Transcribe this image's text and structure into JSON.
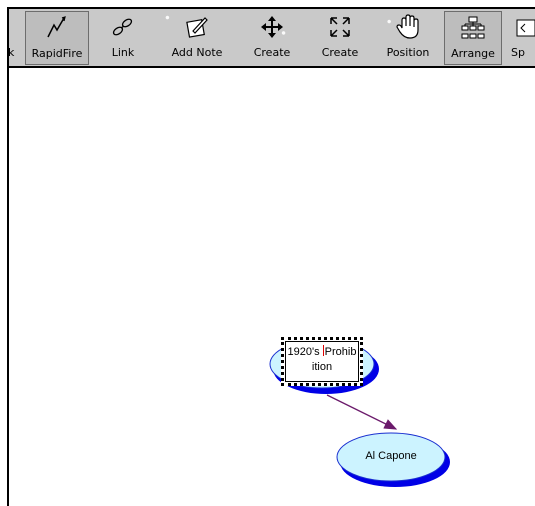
{
  "toolbar": {
    "tools": [
      {
        "label": "k",
        "icon": "partial-tool-icon",
        "active": false
      },
      {
        "label": "RapidFire",
        "icon": "rapidfire-lightning-icon",
        "active": true
      },
      {
        "label": "Link",
        "icon": "link-chain-icon",
        "active": false
      },
      {
        "label": "Add Note",
        "icon": "pencil-note-icon",
        "active": false
      },
      {
        "label": "Create",
        "icon": "create-move-arrows-icon",
        "active": false
      },
      {
        "label": "Create",
        "icon": "create-expand-arrows-icon",
        "active": false
      },
      {
        "label": "Position",
        "icon": "hand-icon",
        "active": false
      },
      {
        "label": "Arrange",
        "icon": "hierarchy-arrange-icon",
        "active": true
      },
      {
        "label": "Sp",
        "icon": "partial-sp-icon",
        "active": false
      }
    ]
  },
  "diagram": {
    "nodes": [
      {
        "id": "prohibition",
        "text_part1": "1920's ",
        "text_part2": "Prohib",
        "text_line2": "ition",
        "editing": true
      },
      {
        "id": "capone",
        "text": "Al Capone",
        "editing": false
      }
    ],
    "links": [
      {
        "from": "prohibition",
        "to": "capone",
        "color": "#6b1a6b"
      }
    ]
  },
  "colors": {
    "node_fill": "#ccf3ff",
    "node_border": "#1a2fd0",
    "node_shadow": "#0000e6",
    "link": "#6b1a6b",
    "toolbar": "#c9c9c9",
    "caret": "#e00000"
  }
}
